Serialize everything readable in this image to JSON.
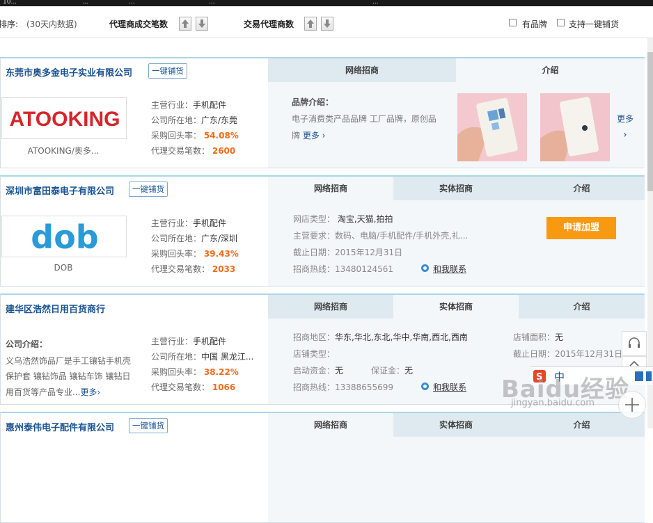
{
  "browser_tabs": [
    "10...",
    "...",
    "...",
    "...",
    "..."
  ],
  "sortbar": {
    "label": "排序:",
    "note": "(30天内数据)",
    "sort1": "代理商成交笔数",
    "sort2": "交易代理商数",
    "filter1": "有品牌",
    "filter2": "支持一键铺货"
  },
  "labels": {
    "industry": "主营行业：",
    "location": "公司所在地：",
    "repurchase": "采购回头率：",
    "trades": "代理交易笔数：",
    "onekey": "一键铺货",
    "more": "更多",
    "contact": "和我联系",
    "apply": "申请加盟"
  },
  "tabs": {
    "online": "网络招商",
    "physical": "实体招商",
    "intro": "介绍"
  },
  "cards": [
    {
      "company": "东莞市奥多金电子实业有限公司",
      "logo_text": "ATOOKING",
      "logo_name": "ATOOKING/奥多...",
      "industry": "手机配件",
      "location": "广东/东莞",
      "repurchase": "54.08%",
      "trades": "2600",
      "brand_label": "品牌介绍：",
      "brand_text1": "电子消费类产品品牌 工厂品牌，原创品",
      "brand_text2": "牌"
    },
    {
      "company": "深圳市富田泰电子有限公司",
      "logo_text": "dob",
      "logo_name": "DOB",
      "industry": "手机配件",
      "location": "广东/深圳",
      "repurchase": "39.43%",
      "trades": "2033",
      "shop_type_label": "网店类型：",
      "shop_type": "淘宝,天猫,拍拍",
      "req_label": "主营要求：",
      "req": "数码、电脑/手机配件/手机外壳,礼...",
      "deadline_label": "截止日期：",
      "deadline": "2015年12月31日",
      "hotline_label": "招商热线：",
      "hotline": "13480124561"
    },
    {
      "company": "建华区浩然日用百货商行",
      "intro_label": "公司介绍：",
      "intro1": "义乌浩然饰品厂是手工镶钻手机壳",
      "intro2": "保护套 镶钻饰品 镶钻车饰 镶钻日",
      "intro3": "用百货等产品专业...",
      "industry": "手机配件",
      "location": "中国 黑龙江...",
      "repurchase": "38.22%",
      "trades": "1066",
      "region_label": "招商地区：",
      "region": "华东,华北,东北,华中,华南,西北,西南",
      "shop_type_label": "店铺类型：",
      "shop_type": "",
      "capital_label": "启动资金：",
      "capital": "无",
      "deposit_label": "保证金：",
      "deposit": "无",
      "hotline_label": "招商热线：",
      "hotline": "13388655699",
      "area_label": "店铺面积：",
      "area": "无",
      "deadline_label": "截止日期：",
      "deadline": "2015年12月31日"
    },
    {
      "company": "惠州泰伟电子配件有限公司"
    }
  ],
  "watermark": {
    "main": "Baidu经验",
    "sub": "jingyan.baidu.com",
    "ime": "中"
  },
  "colors": {
    "brand_blue": "#1b5291",
    "orange": "#f26a1b",
    "apply_orange": "#f79a12",
    "tab_bg": "#dfeaf0"
  }
}
